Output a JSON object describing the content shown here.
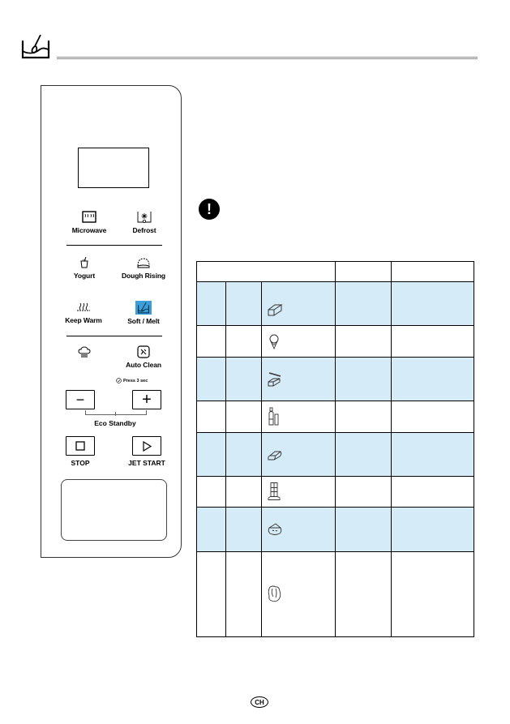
{
  "header": {
    "icon": "soft-melt-icon"
  },
  "control_panel": {
    "keys": [
      {
        "id": "microwave",
        "label": "Microwave",
        "icon": "microwave-icon"
      },
      {
        "id": "defrost",
        "label": "Defrost",
        "icon": "defrost-icon"
      },
      {
        "id": "yogurt",
        "label": "Yogurt",
        "icon": "yogurt-icon"
      },
      {
        "id": "dough-rising",
        "label": "Dough Rising",
        "icon": "dough-icon"
      },
      {
        "id": "keep-warm",
        "label": "Keep Warm",
        "icon": "keep-warm-icon"
      },
      {
        "id": "soft-melt",
        "label": "Soft / Melt",
        "icon": "soft-melt-icon",
        "highlighted": true,
        "highlight_color": "#3a9fd8"
      },
      {
        "id": "chef",
        "label": "",
        "icon": "chef-hat-icon"
      },
      {
        "id": "auto-clean",
        "label": "Auto Clean",
        "icon": "auto-clean-icon"
      }
    ],
    "press_hint": "Press 3 sec",
    "minus_symbol": "−",
    "plus_symbol": "+",
    "eco_label": "Eco Standby",
    "stop_label": "STOP",
    "start_label": "JET START"
  },
  "warning": {
    "symbol": "!"
  },
  "table": {
    "shade_color": "#d6ebf8",
    "header": [
      "",
      "",
      ""
    ],
    "rows": [
      {
        "icon": "butter-icon",
        "shaded": true
      },
      {
        "icon": "ice-cream-icon",
        "shaded": false
      },
      {
        "icon": "butter-knife-icon",
        "shaded": true
      },
      {
        "icon": "bottles-icon",
        "shaded": false
      },
      {
        "icon": "cheese-block-icon",
        "shaded": true
      },
      {
        "icon": "chocolate-icon",
        "shaded": false
      },
      {
        "icon": "cheese-icon",
        "shaded": true
      },
      {
        "icon": "marshmallow-icon",
        "shaded": false
      }
    ]
  },
  "footer": {
    "badge": "CH"
  }
}
